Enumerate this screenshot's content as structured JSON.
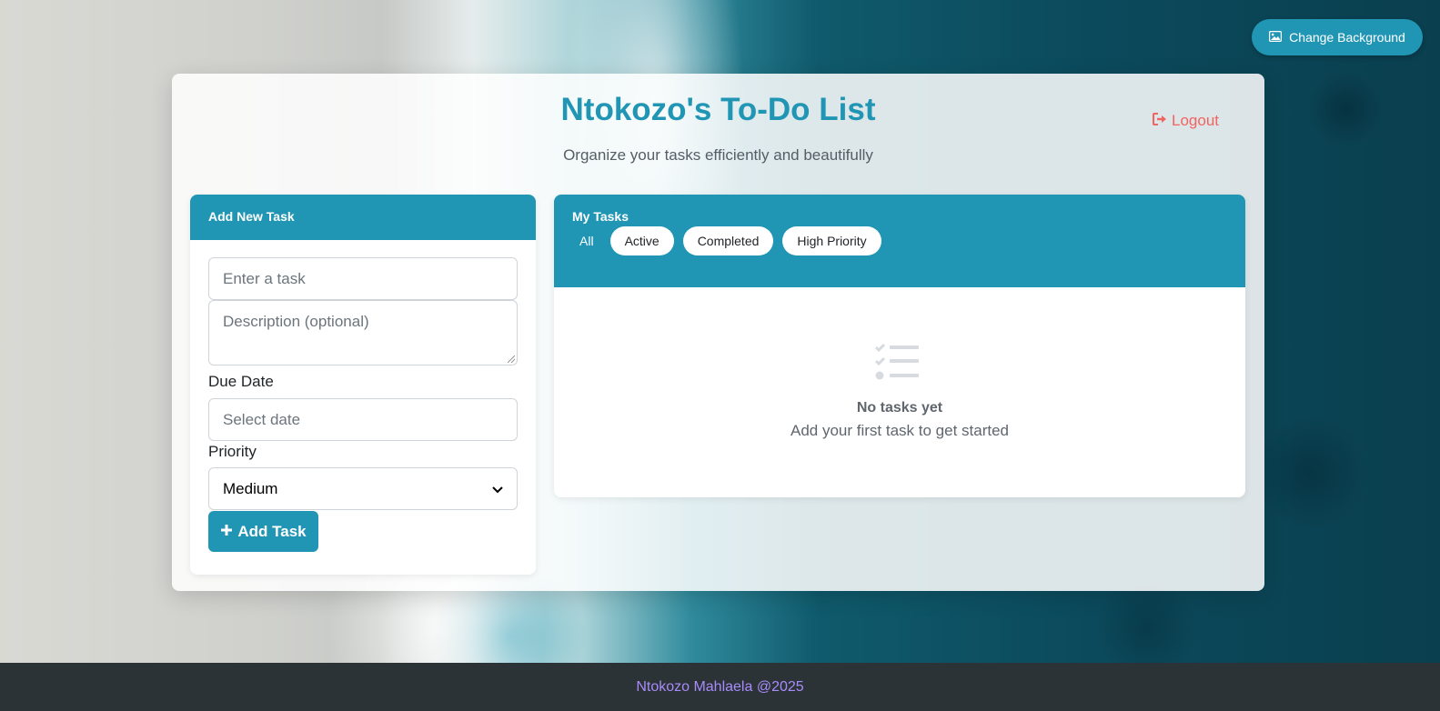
{
  "background_button": {
    "label": "Change Background",
    "icon": "image-icon"
  },
  "header": {
    "title": "Ntokozo's To-Do List",
    "subtitle": "Organize your tasks efficiently and beautifully",
    "logout_label": "Logout"
  },
  "add_task": {
    "heading": "Add New Task",
    "task_placeholder": "Enter a task",
    "description_placeholder": "Description (optional)",
    "due_date_label": "Due Date",
    "due_date_placeholder": "Select date",
    "priority_label": "Priority",
    "priority_selected": "Medium",
    "button_label": "Add Task"
  },
  "tasks": {
    "heading": "My Tasks",
    "filters": [
      {
        "label": "All",
        "active": true
      },
      {
        "label": "Active",
        "active": false
      },
      {
        "label": "Completed",
        "active": false
      },
      {
        "label": "High Priority",
        "active": false
      }
    ],
    "empty_title": "No tasks yet",
    "empty_subtitle": "Add your first task to get started"
  },
  "footer": {
    "text": "Ntokozo Mahlaela @2025"
  },
  "colors": {
    "primary": "#2196b4",
    "logout": "#f2645f",
    "footer_bg": "#2c3337",
    "footer_text": "#a78bfa"
  }
}
